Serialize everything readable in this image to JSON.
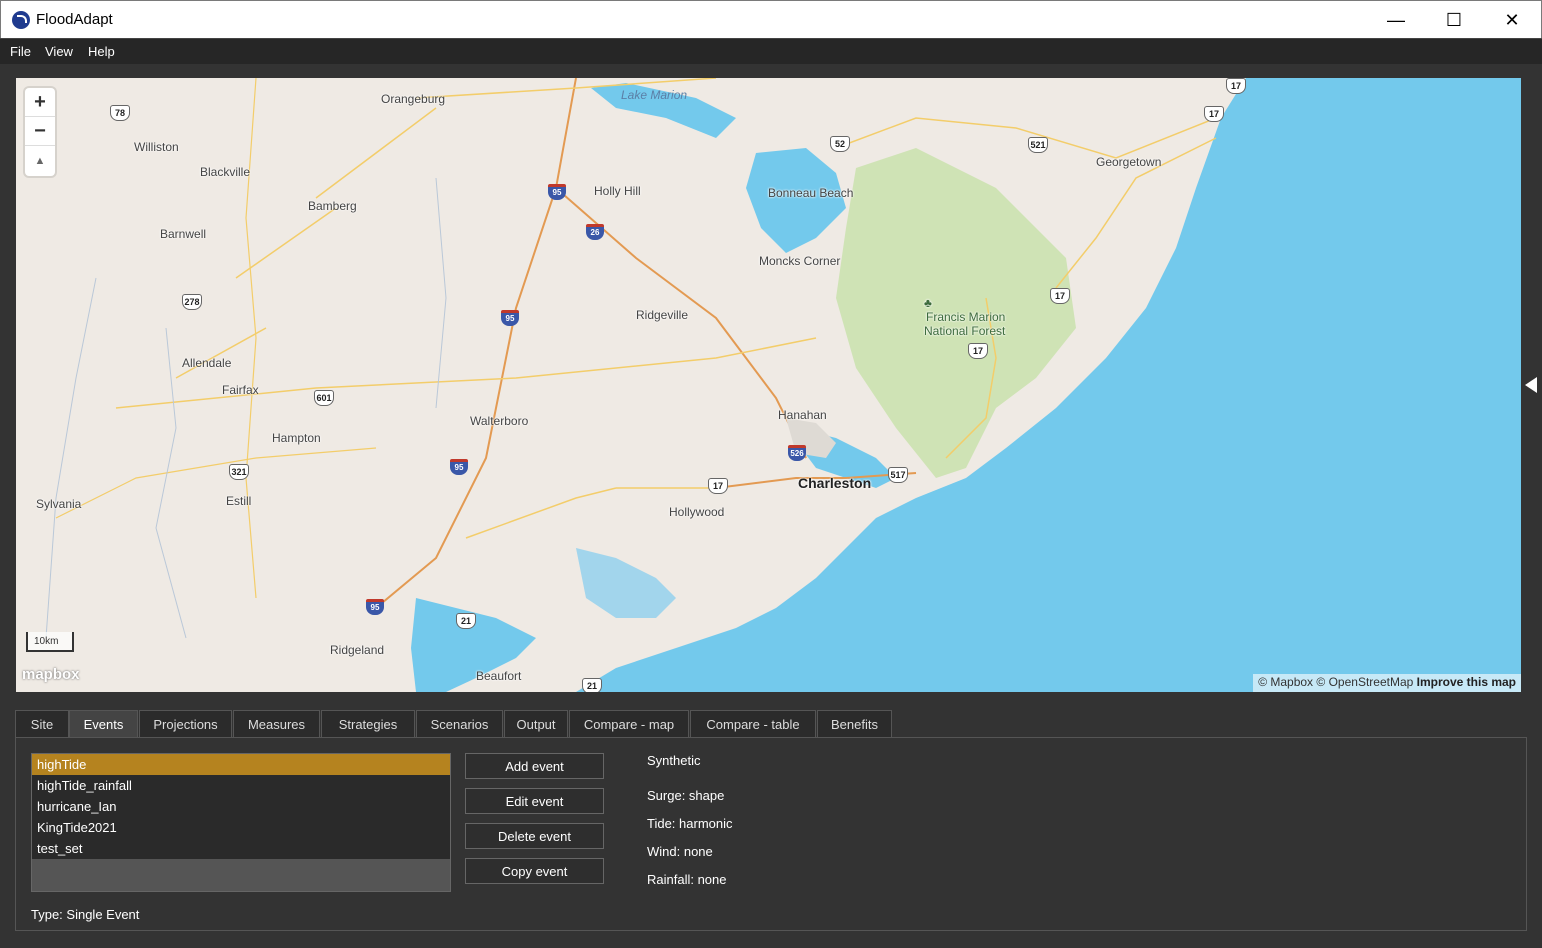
{
  "window": {
    "title": "FloodAdapt"
  },
  "menu": [
    "File",
    "View",
    "Help"
  ],
  "map": {
    "labels": {
      "orangeburg": "Orangeburg",
      "lake_marion": "Lake Marion",
      "williston": "Williston",
      "blackville": "Blackville",
      "holly_hill": "Holly Hill",
      "bonneau_beach": "Bonneau Beach",
      "georgetown": "Georgetown",
      "bamberg": "Bamberg",
      "barnwell": "Barnwell",
      "moncks_corner": "Moncks Corner",
      "ridgeville": "Ridgeville",
      "francis_marion_1": "Francis Marion",
      "francis_marion_2": "National Forest",
      "allendale": "Allendale",
      "fairfax": "Fairfax",
      "hanahan": "Hanahan",
      "walterboro": "Walterboro",
      "hampton": "Hampton",
      "charleston": "Charleston",
      "estill": "Estill",
      "sylvania": "Sylvania",
      "hollywood": "Hollywood",
      "ridgeland": "Ridgeland",
      "beaufort": "Beaufort"
    },
    "shields": {
      "us78": "78",
      "us52": "52",
      "us17a": "17",
      "us17b": "17",
      "us521": "521",
      "us278": "278",
      "us17c": "17",
      "us17d": "17",
      "us601": "601",
      "us321": "321",
      "us17e": "17",
      "sc517": "517",
      "us21a": "21",
      "us21b": "21"
    },
    "interstates": {
      "i95a": "95",
      "i26": "26",
      "i95b": "95",
      "i526": "526",
      "i95c": "95",
      "i95d": "95"
    },
    "scale": "10km",
    "logo": "mapbox",
    "attribution": {
      "mapbox": "© Mapbox",
      "osm": "© OpenStreetMap",
      "improve": "Improve this map"
    },
    "controls": {
      "zoom_in": "+",
      "zoom_out": "−",
      "compass": "▲"
    }
  },
  "tabs": [
    {
      "label": "Site"
    },
    {
      "label": "Events"
    },
    {
      "label": "Projections"
    },
    {
      "label": "Measures"
    },
    {
      "label": "Strategies"
    },
    {
      "label": "Scenarios"
    },
    {
      "label": "Output"
    },
    {
      "label": "Compare - map"
    },
    {
      "label": "Compare - table"
    },
    {
      "label": "Benefits"
    }
  ],
  "active_tab": "Events",
  "events": {
    "list": [
      "highTide",
      "highTide_rainfall",
      "hurricane_Ian",
      "KingTide2021",
      "test_set"
    ],
    "selected": "highTide",
    "buttons": {
      "add": "Add event",
      "edit": "Edit event",
      "delete": "Delete event",
      "copy": "Copy event"
    },
    "details": {
      "kind": "Synthetic",
      "surge": "Surge: shape",
      "tide": "Tide: harmonic",
      "wind": "Wind: none",
      "rainfall": "Rainfall: none"
    },
    "type": "Type: Single Event"
  },
  "colors": {
    "selected_item": "#b5831f",
    "water": "#73c9ec",
    "land": "#efeae4",
    "forest": "#cfe3b5",
    "panel": "#333333"
  }
}
